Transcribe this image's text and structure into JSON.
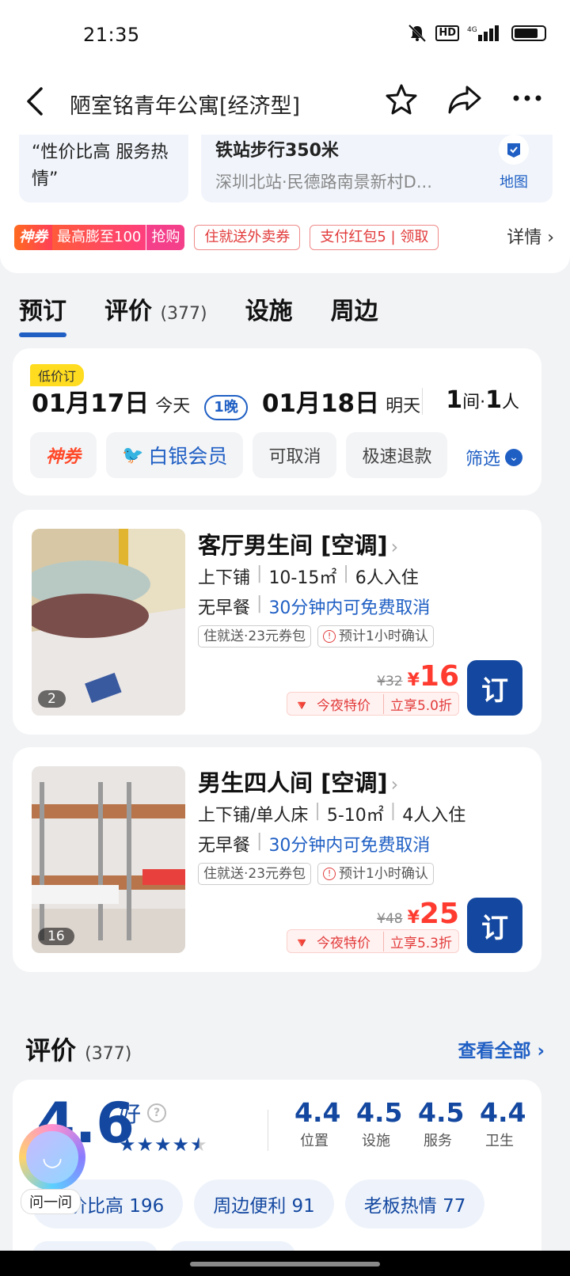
{
  "status": {
    "time": "21:35",
    "hd": "HD",
    "signal": "⁴⁶"
  },
  "header": {
    "title": "陋室铭青年公寓[经济型]"
  },
  "top": {
    "review_quote": "“性价比高 服务热情”",
    "loc_line1": "铁站步行350米",
    "loc_line2": "深圳北站·民德路南景新村D...",
    "map_label": "地图"
  },
  "promos": {
    "shen_a": "神券",
    "shen_b": "最高膨至100",
    "shen_c": "抢购",
    "tag1": "住就送外卖券",
    "tag2": "支付红包5 | 领取",
    "detail": "详情"
  },
  "tabs": [
    {
      "label": "预订"
    },
    {
      "label": "评价",
      "count": "(377)"
    },
    {
      "label": "设施"
    },
    {
      "label": "周边"
    }
  ],
  "booking": {
    "low_tag": "低价订",
    "checkin_day": "01月17日",
    "checkin_note": "今天",
    "nights": "1晚",
    "checkout_day": "01月18日",
    "checkout_note": "明天",
    "rooms_num": "1",
    "rooms_unit": "间",
    "dot": "·",
    "people_num": "1",
    "people_unit": "人",
    "filters": [
      "神券",
      "白银会员",
      "可取消",
      "极速退款"
    ],
    "filter_btn": "筛选"
  },
  "rooms": [
    {
      "name": "客厅男生间 [空调]",
      "bed": "上下铺",
      "area": "10-15㎡",
      "occupancy": "6人入住",
      "breakfast": "无早餐",
      "cancel": "30分钟内可免费取消",
      "chip1": "住就送·23元券包",
      "chip2": "预计1小时确认",
      "old_price": "¥32",
      "price": "16",
      "deal1": "今夜特价",
      "deal2": "立享5.0折",
      "book": "订",
      "img_count": "2"
    },
    {
      "name": "男生四人间 [空调]",
      "bed": "上下铺/单人床",
      "area": "5-10㎡",
      "occupancy": "4人入住",
      "breakfast": "无早餐",
      "cancel": "30分钟内可免费取消",
      "chip1": "住就送·23元券包",
      "chip2": "预计1小时确认",
      "old_price": "¥48",
      "price": "25",
      "deal1": "今夜特价",
      "deal2": "立享5.3折",
      "book": "订",
      "img_count": "16"
    }
  ],
  "reviews": {
    "title": "评价",
    "count": "(377)",
    "see_all": "查看全部",
    "score": "4.6",
    "rating_word": "好",
    "stars": 4.5,
    "subscores": [
      {
        "value": "4.4",
        "label": "位置"
      },
      {
        "value": "4.5",
        "label": "设施"
      },
      {
        "value": "4.5",
        "label": "服务"
      },
      {
        "value": "4.4",
        "label": "卫生"
      }
    ],
    "tags": [
      "性价比高 196",
      "周边便利 91",
      "老板热情 77"
    ]
  },
  "assistant": {
    "label": "问一问"
  },
  "colors": {
    "accent": "#1f5fc4",
    "dark_blue": "#1448a0",
    "price_red": "#ff3b30"
  }
}
